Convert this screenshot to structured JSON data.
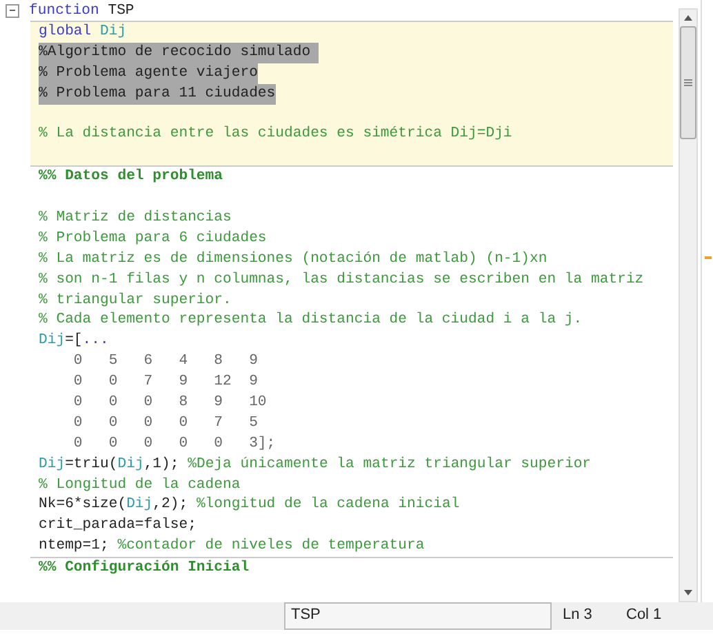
{
  "editor": {
    "header_line": [
      {
        "kind": "keyword",
        "text": "function"
      },
      {
        "kind": "plain",
        "text": " TSP"
      }
    ],
    "cells": [
      {
        "current": true,
        "lines": [
          {
            "selected": false,
            "segments": [
              {
                "kind": "keyword",
                "text": "global"
              },
              {
                "kind": "var",
                "text": " Dij"
              }
            ]
          },
          {
            "selected": true,
            "segments": [
              {
                "kind": "plain",
                "text": "%Algoritmo de recocido simulado "
              }
            ]
          },
          {
            "selected": true,
            "segments": [
              {
                "kind": "plain",
                "text": "% Problema agente viajero"
              }
            ]
          },
          {
            "selected": true,
            "segments": [
              {
                "kind": "plain",
                "text": "% Problema para 11 ciudades"
              }
            ]
          },
          {
            "selected": false
          },
          {
            "selected": false,
            "segments": [
              {
                "kind": "comment",
                "text": "% La distancia entre las ciudades es simétrica Dij=Dji"
              }
            ]
          },
          {
            "selected": false
          }
        ]
      },
      {
        "current": false,
        "lines": [
          {
            "selected": false,
            "segments": [
              {
                "kind": "cell-title",
                "text": "%% Datos del problema"
              }
            ]
          },
          {
            "selected": false
          },
          {
            "selected": false,
            "segments": [
              {
                "kind": "comment",
                "text": "% Matriz de distancias"
              }
            ]
          },
          {
            "selected": false,
            "segments": [
              {
                "kind": "comment",
                "text": "% Problema para 6 ciudades"
              }
            ]
          },
          {
            "selected": false,
            "segments": [
              {
                "kind": "comment",
                "text": "% La matriz es de dimensiones (notación de matlab) (n-1)xn"
              }
            ]
          },
          {
            "selected": false,
            "segments": [
              {
                "kind": "comment",
                "text": "% son n-1 filas y n columnas, las distancias se escriben en la matriz"
              }
            ]
          },
          {
            "selected": false,
            "segments": [
              {
                "kind": "comment",
                "text": "% triangular superior."
              }
            ]
          },
          {
            "selected": false,
            "segments": [
              {
                "kind": "comment",
                "text": "% Cada elemento representa la distancia de la ciudad i a la j."
              }
            ]
          },
          {
            "selected": false,
            "segments": [
              {
                "kind": "var",
                "text": "Dij"
              },
              {
                "kind": "plain",
                "text": "=["
              },
              {
                "kind": "keyword",
                "text": "..."
              }
            ]
          },
          {
            "selected": false,
            "segments": [
              {
                "kind": "number",
                "text": "    0   5   6   4   8   9"
              }
            ]
          },
          {
            "selected": false,
            "segments": [
              {
                "kind": "number",
                "text": "    0   0   7   9   12  9"
              }
            ]
          },
          {
            "selected": false,
            "segments": [
              {
                "kind": "number",
                "text": "    0   0   0   8   9   10"
              }
            ]
          },
          {
            "selected": false,
            "segments": [
              {
                "kind": "number",
                "text": "    0   0   0   0   7   5"
              }
            ]
          },
          {
            "selected": false,
            "segments": [
              {
                "kind": "number",
                "text": "    0   0   0   0   0   3];"
              }
            ]
          },
          {
            "selected": false,
            "segments": [
              {
                "kind": "var",
                "text": "Dij"
              },
              {
                "kind": "plain",
                "text": "=triu("
              },
              {
                "kind": "var",
                "text": "Dij"
              },
              {
                "kind": "plain",
                "text": ",1); "
              },
              {
                "kind": "comment",
                "text": "%Deja únicamente la matriz triangular superior"
              }
            ]
          },
          {
            "selected": false,
            "segments": [
              {
                "kind": "comment",
                "text": "% Longitud de la cadena"
              }
            ]
          },
          {
            "selected": false,
            "segments": [
              {
                "kind": "plain",
                "text": "Nk=6*size("
              },
              {
                "kind": "var",
                "text": "Dij"
              },
              {
                "kind": "plain",
                "text": ",2); "
              },
              {
                "kind": "comment",
                "text": "%longitud de la cadena inicial"
              }
            ]
          },
          {
            "selected": false,
            "segments": [
              {
                "kind": "plain",
                "text": "crit_parada=false;"
              }
            ]
          },
          {
            "selected": false,
            "segments": [
              {
                "kind": "plain",
                "text": "ntemp=1; "
              },
              {
                "kind": "comment",
                "text": "%contador de niveles de temperatura"
              }
            ]
          }
        ]
      },
      {
        "current": false,
        "lines": [
          {
            "selected": false,
            "segments": [
              {
                "kind": "cell-title",
                "text": "%% Configuración Inicial"
              }
            ]
          }
        ]
      }
    ]
  },
  "status_bar": {
    "file": "TSP",
    "line": "Ln 3",
    "column": "Col 1"
  }
}
